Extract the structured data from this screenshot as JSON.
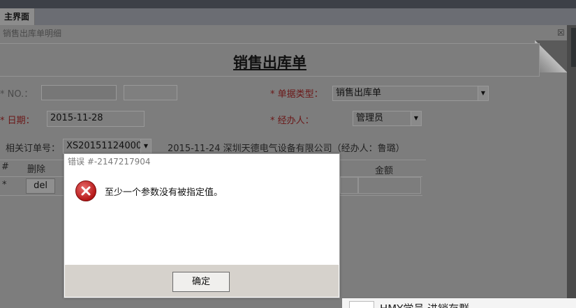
{
  "tab": {
    "label": "主界面"
  },
  "panel": {
    "title": "销售出库单明细",
    "close_glyph": "☒"
  },
  "form": {
    "title": "销售出库单",
    "no_label": "* NO.：",
    "doc_type_label": "* 单据类型：",
    "doc_type_value": "销售出库单",
    "date_label": "* 日期：",
    "date_value": "2015-11-28",
    "handler_label": "* 经办人：",
    "handler_value": "管理员",
    "order_label": "相关订单号：",
    "order_value": "XS20151124000",
    "order_info": "2015-11-24 深圳天德电气设备有限公司（经办人：鲁璐）"
  },
  "grid": {
    "col_index": "#",
    "col_delete": "删除",
    "col_amount": "金额",
    "row_marker": "*",
    "delete_button": "del"
  },
  "dialog": {
    "title": "错误 #-2147217904",
    "message": "至少一个参数没有被指定值。",
    "ok_button": "确定",
    "icon": "error-icon"
  },
  "bottom": {
    "text": "HMY学员 进销存群"
  },
  "colors": {
    "error_red": "#b51818",
    "label_red": "#6b1717"
  }
}
